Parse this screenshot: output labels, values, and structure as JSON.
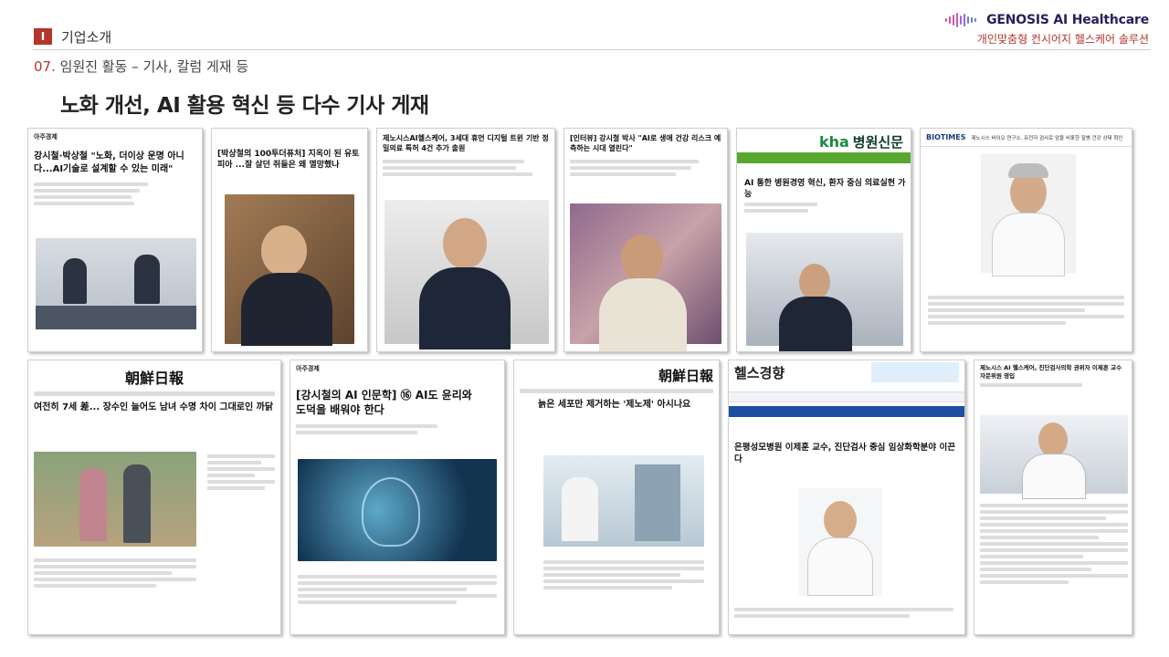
{
  "header": {
    "section_num": "I",
    "section_title": "기업소개"
  },
  "subheader": {
    "num": "07.",
    "text": "임원진 활동 – 기사, 칼럼 게재 등"
  },
  "headline": "노화 개선, AI 활용 혁신 등 다수 기사 게재",
  "brand": {
    "name": "GENOSIS AI Healthcare",
    "tagline": "개인맞춤형 컨시어지 헬스케어 솔루션",
    "accent": "#b3362d",
    "navy": "#2a1e5c"
  },
  "clips": [
    {
      "publication": "아주경제",
      "title": "강시철·박상철 \"노화, 더이상 운명 아니다...AI기술로 설계할 수 있는 미래\""
    },
    {
      "publication": "",
      "title": "[박상철의 100투더퓨처] 지옥이 된 유토피아 ...잘 살던 쥐들은 왜 멸망했나"
    },
    {
      "publication": "",
      "title": "제노시스AI헬스케어, 3세대 휴먼 디지털 트윈 기반 정밀의료 특허 4건 추가 출원"
    },
    {
      "publication": "",
      "title": "[인터뷰] 강시철 박사 \"AI로 생애 건강 리스크 예측하는 시대 열린다\""
    },
    {
      "publication": "병원신문",
      "title": "AI 통한 병원경영 혁신, 환자 중심 의료실현 가능"
    },
    {
      "publication": "BIOTIMES",
      "title": "제노시스 바이오 연구소, 유전자 검사로 암을 비롯한 질병·건강 상태 확인"
    },
    {
      "publication": "朝鮮日報",
      "title": "여전히 7세 差... 장수인 늘어도 남녀 수명 차이 그대로인 까닭"
    },
    {
      "publication": "아주경제",
      "title": "[강시철의 AI 인문학] ⑯ AI도 윤리와 도덕을 배워야 한다"
    },
    {
      "publication": "朝鮮日報",
      "title": "늙은 세포만 제거하는 '제노제' 아시나요"
    },
    {
      "publication": "헬스경향",
      "title": "은평성모병원 이제훈 교수, 진단검사 중심 임상화학분야 이끈다"
    },
    {
      "publication": "",
      "title": "제노시스 AI 헬스케어, 진단검사의학 권위자 이제훈 교수 자문위원 영입"
    }
  ]
}
